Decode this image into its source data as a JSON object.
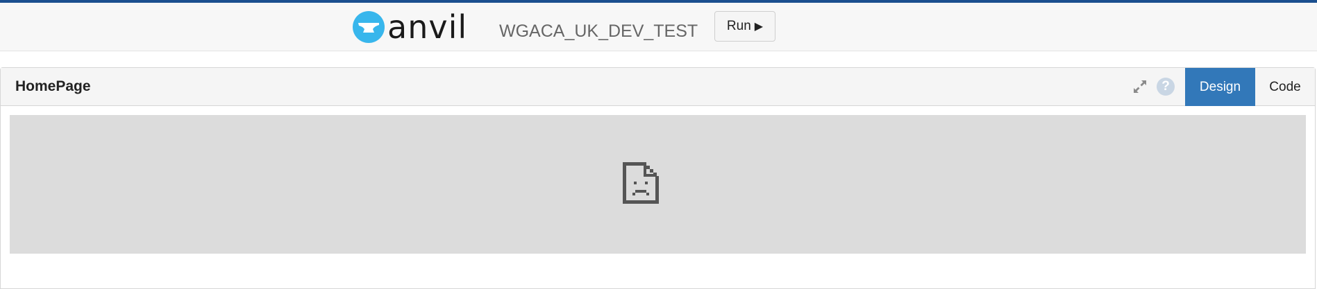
{
  "header": {
    "logo_text": "anvil",
    "app_name": "WGACA_UK_DEV_TEST",
    "run_label": "Run",
    "run_icon": "play-icon"
  },
  "panel": {
    "title": "HomePage",
    "tabs": [
      {
        "label": "Design",
        "active": true
      },
      {
        "label": "Code",
        "active": false
      }
    ],
    "help_symbol": "?",
    "icons": [
      "expand-icon",
      "help-icon"
    ],
    "content_icon": "broken-document-icon"
  },
  "colors": {
    "accent": "#1b4f8f",
    "active_tab": "#3278b9",
    "logo_blue": "#38b6ec",
    "help_icon": "#c9d6e4",
    "canvas_bg": "#dcdcdc"
  }
}
